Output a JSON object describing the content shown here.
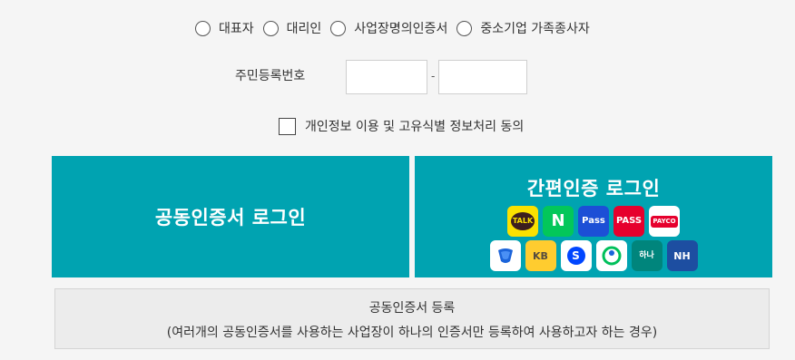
{
  "role_options": [
    {
      "label": "대표자"
    },
    {
      "label": "대리인"
    },
    {
      "label": "사업장명의인증서"
    },
    {
      "label": "중소기업 가족종사자"
    }
  ],
  "rrn": {
    "label": "주민등록번호",
    "separator": "-",
    "front_value": "",
    "back_value": ""
  },
  "consent": {
    "label": "개인정보 이용 및 고유식별 정보처리 동의",
    "checked": false
  },
  "cert_login": {
    "label": "공동인증서 로그인",
    "color": "#00a3b1"
  },
  "simple_login": {
    "title": "간편인증 로그인",
    "providers_row1": [
      {
        "icon": "kakaotalk-icon",
        "text": "TALK",
        "bg": "#fae100",
        "fg": "#3c1e1e"
      },
      {
        "icon": "naver-icon",
        "text": "N",
        "bg": "#03c75a",
        "fg": "#ffffff"
      },
      {
        "icon": "samsung-pass-icon",
        "text": "Pass",
        "bg": "#1c4fd6",
        "fg": "#ffffff"
      },
      {
        "icon": "pass-icon",
        "text": "PASS",
        "bg": "#e6002d",
        "fg": "#ffffff"
      },
      {
        "icon": "payco-icon",
        "text": "PAYCO",
        "bg": "#ffffff",
        "fg": "#e6002d"
      }
    ],
    "providers_row2": [
      {
        "icon": "toss-icon",
        "text": "",
        "bg": "#ffffff",
        "fg": "#1b64da"
      },
      {
        "icon": "kb-bank-icon",
        "text": "KB",
        "bg": "#ffcc2f",
        "fg": "#544b3f"
      },
      {
        "icon": "shinhan-bank-icon",
        "text": "S",
        "bg": "#ffffff",
        "fg": "#0046ff"
      },
      {
        "icon": "banksalad-icon",
        "text": "",
        "bg": "#ffffff",
        "fg": "#00c05b"
      },
      {
        "icon": "hana-bank-icon",
        "text": "하나",
        "bg": "#00857c",
        "fg": "#ffffff"
      },
      {
        "icon": "nh-bank-icon",
        "text": "NH",
        "bg": "#1d4ea1",
        "fg": "#ffffff"
      }
    ]
  },
  "register": {
    "title": "공동인증서 등록",
    "description": "(여러개의 공동인증서를 사용하는 사업장이 하나의 인증서만 등록하여 사용하고자 하는 경우)"
  }
}
